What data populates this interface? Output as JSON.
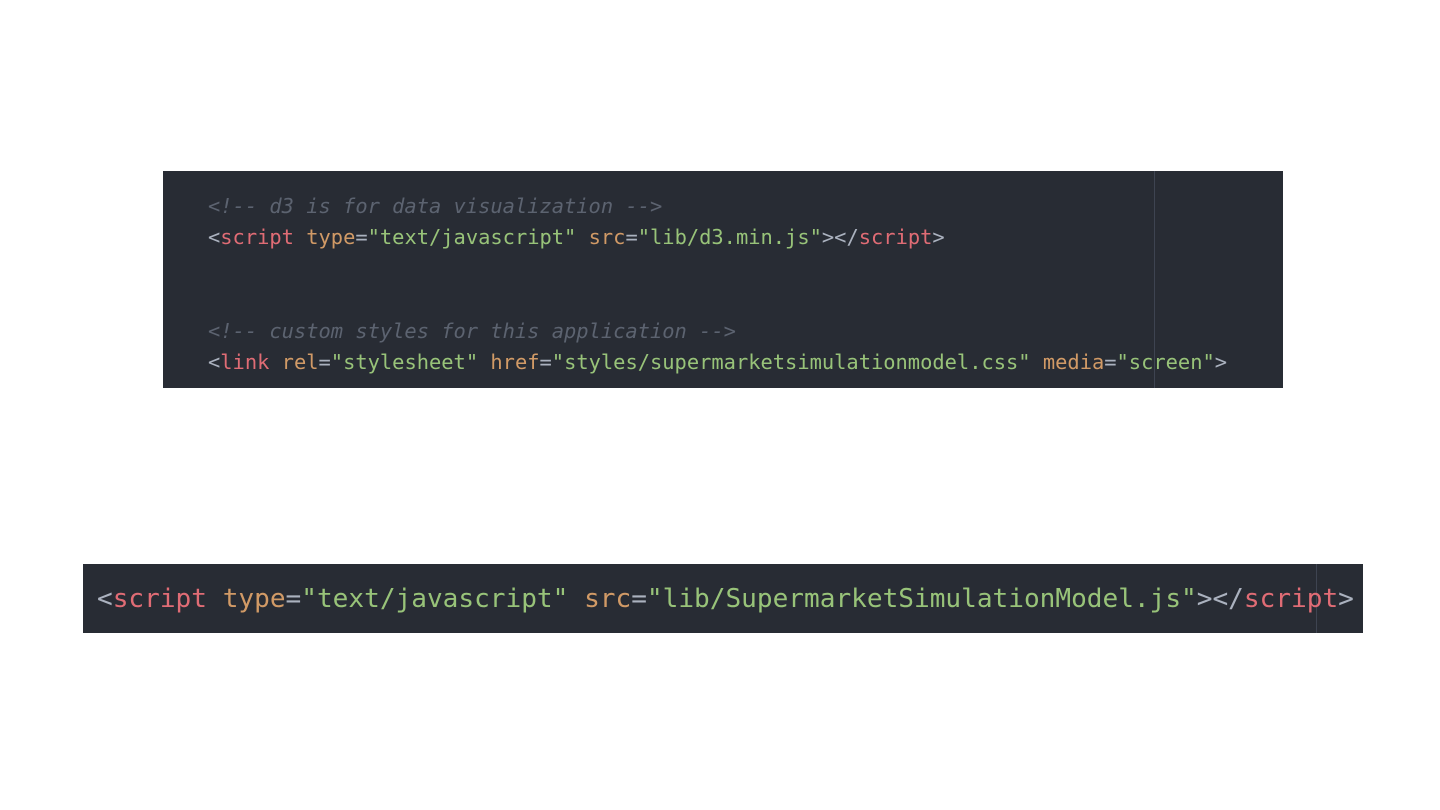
{
  "colors": {
    "page_background": "#ffffff",
    "editor_background": "#282c34",
    "comment": "#5c6370",
    "punctuation": "#abb2bf",
    "tag": "#e06c75",
    "attribute": "#d19a66",
    "string": "#98c379",
    "indent_guide": "#3e4451"
  },
  "top_snippet": {
    "comment_1": "<!-- d3 is for data visualization -->",
    "script_line": {
      "open_bracket": "<",
      "tag": "script",
      "attr_1_name": "type",
      "attr_1_value": "\"text/javascript\"",
      "attr_2_name": "src",
      "attr_2_value": "\"lib/d3.min.js\"",
      "close_open_tag": "></",
      "close_tag": "script",
      "final_bracket": ">"
    },
    "comment_2": "<!-- custom styles for this application -->",
    "link_line": {
      "open_bracket": "<",
      "tag": "link",
      "attr_1_name": "rel",
      "attr_1_value": "\"stylesheet\"",
      "attr_2_name": "href",
      "attr_2_value": "\"styles/supermarketsimulationmodel.css\"",
      "attr_3_name": "media",
      "attr_3_value": "\"screen\"",
      "final_bracket": ">"
    }
  },
  "bottom_snippet": {
    "script_line": {
      "open_bracket": "<",
      "tag": "script",
      "attr_1_name": "type",
      "attr_1_value": "\"text/javascript\"",
      "attr_2_name": "src",
      "attr_2_value": "\"lib/SupermarketSimulationModel.js\"",
      "close_open_tag": "></",
      "close_tag": "script",
      "final_bracket": ">"
    }
  }
}
